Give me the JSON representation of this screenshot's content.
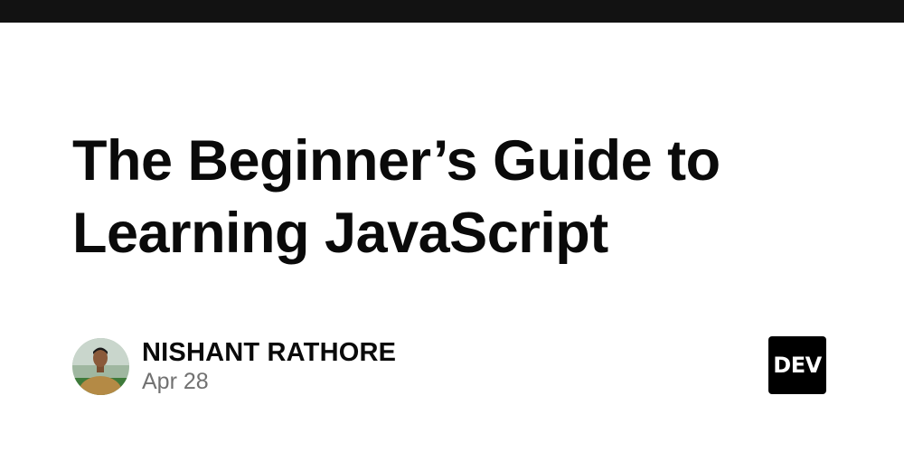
{
  "article": {
    "title_line1": "The Beginner’s Guide to",
    "title_line2": "Learning JavaScript"
  },
  "author": {
    "name": "NISHANT RATHORE",
    "date": "Apr 28"
  },
  "brand": {
    "logo_text": "DEV",
    "logo_icon": "dev-logo-icon",
    "top_bar_color": "#121212",
    "logo_bg_color": "#000000"
  }
}
